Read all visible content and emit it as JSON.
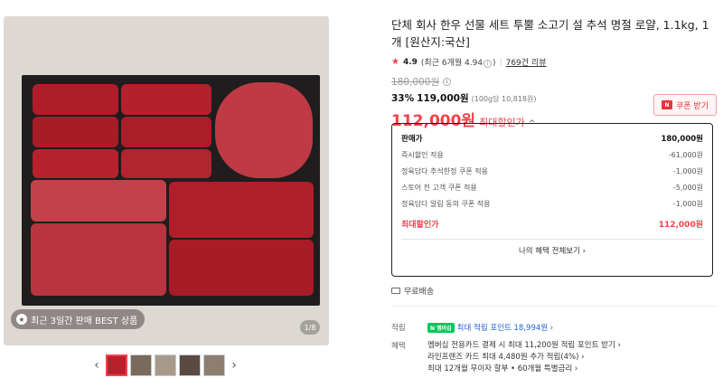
{
  "gallery": {
    "best_badge": "최근 3일간 판매 BEST 상품",
    "page_indicator": "1/8",
    "thumb_prev": "‹",
    "thumb_next": "›",
    "thumbnails": [
      {
        "color": "#b8202c"
      },
      {
        "color": "#7a6a5c"
      },
      {
        "color": "#a89a8a"
      },
      {
        "color": "#5a4a42"
      },
      {
        "color": "#8e7e70"
      }
    ]
  },
  "product": {
    "title": "단체 회사 한우 선물 세트 투뿔 소고기 설 추석 명절 로얄, 1.1kg, 1개 [원산지:국산]",
    "rating_star": "★",
    "rating_score": "4.9",
    "rating_detail": "(최근 6개월 4.94",
    "rating_info": "ⓘ",
    "rating_close": ")",
    "review_link": "769건 리뷰",
    "original_price": "180,000원",
    "discount_rate": "33%",
    "sale_price": "119,000원",
    "unit_price": "(100g당 10,818원)",
    "max_price": "112,000원",
    "max_label": "최대할인가",
    "max_toggle": "^",
    "coupon_label": "쿠폰 받기",
    "coupon_icon": "N"
  },
  "price_box": {
    "rows": [
      {
        "label": "판매가",
        "value": "180,000원"
      },
      {
        "label": "즉시할인 적용",
        "value": "-61,000원"
      },
      {
        "label": "정육담다 추석한정 쿠폰 적용",
        "value": "-1,000원"
      },
      {
        "label": "스토어 전 고객 쿠폰 적용",
        "value": "-5,000원"
      },
      {
        "label": "정육담다 알림 동의 쿠폰 적용",
        "value": "-1,000원"
      }
    ],
    "final_label": "최대할인가",
    "final_value": "112,000원",
    "more_label": "나의 혜택 전체보기 ›"
  },
  "shipping": {
    "label": "무료배송"
  },
  "points": {
    "label": "적립",
    "badge": "N 멤버십",
    "text": "최대 적립 포인트 18,994원 ›"
  },
  "benefits": {
    "label": "혜택",
    "lines": [
      "멤버십 전용카드 결제 시 최대 11,200원 적립 포인트 받기 ›",
      "라인프렌즈 카드 최대 4,480원 추가 적립(4%) ›",
      "최대 12개월 무이자 할부 • 60개월 특별금리 ›"
    ]
  }
}
